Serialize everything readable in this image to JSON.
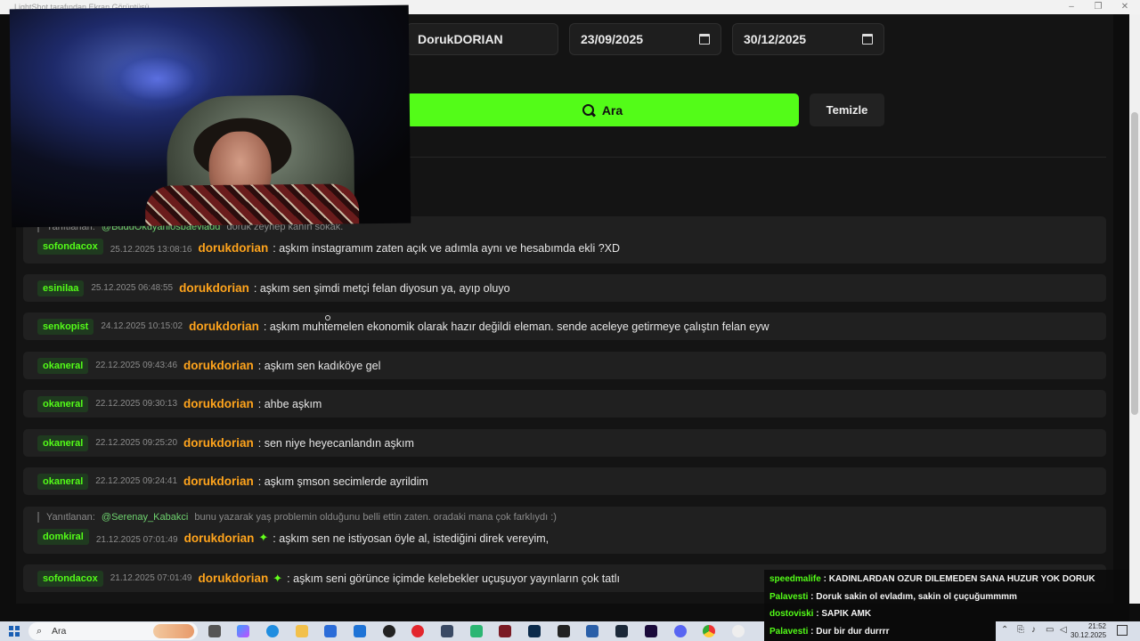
{
  "window": {
    "title": "LightShot tarafından Ekran Görüntüsü"
  },
  "filters": {
    "username": "DorukDORIAN",
    "date_from": "23/09/2025",
    "date_to": "30/12/2025",
    "search_label": "Ara",
    "clear_label": "Temizle"
  },
  "messages": [
    {
      "reply_label": "Yanıtlanan:",
      "reply_to": "@BuduOkuyaniosbaeviadd",
      "reply_text": "doruk zeynep kanın sokak.",
      "user": "sofondacox",
      "timestamp": "25.12.2025 13:08:16",
      "author": "dorukdorian",
      "sparkle": false,
      "text": ": aşkım instagramım zaten açık ve adımla aynı ve hesabımda ekli ?XD"
    },
    {
      "user": "esinilaa",
      "timestamp": "25.12.2025 06:48:55",
      "author": "dorukdorian",
      "sparkle": false,
      "text": ": aşkım sen şimdi metçi felan diyosun ya, ayıp oluyo"
    },
    {
      "user": "senkopist",
      "timestamp": "24.12.2025 10:15:02",
      "author": "dorukdorian",
      "sparkle": false,
      "text": ": aşkım muhtemelen ekonomik olarak hazır değildi eleman. sende aceleye getirmeye çalıştın felan eyw"
    },
    {
      "user": "okaneral",
      "timestamp": "22.12.2025 09:43:46",
      "author": "dorukdorian",
      "sparkle": false,
      "text": ": aşkım sen kadıköye gel"
    },
    {
      "user": "okaneral",
      "timestamp": "22.12.2025 09:30:13",
      "author": "dorukdorian",
      "sparkle": false,
      "text": ": ahbe aşkım"
    },
    {
      "user": "okaneral",
      "timestamp": "22.12.2025 09:25:20",
      "author": "dorukdorian",
      "sparkle": false,
      "text": ": sen niye heyecanlandın aşkım"
    },
    {
      "user": "okaneral",
      "timestamp": "22.12.2025 09:24:41",
      "author": "dorukdorian",
      "sparkle": false,
      "text": ": aşkım şmson secimlerde ayrildim"
    },
    {
      "reply_label": "Yanıtlanan:",
      "reply_to": "@Serenay_Kabakci",
      "reply_text": "bunu yazarak yaş problemin olduğunu belli ettin zaten. oradaki mana çok farklıydı :)",
      "user": "domkiral",
      "timestamp": "21.12.2025 07:01:49",
      "author": "dorukdorian",
      "sparkle": true,
      "text": ": aşkım sen ne istiyosan öyle al, istediğini direk vereyim,"
    },
    {
      "user": "sofondacox",
      "timestamp": "21.12.2025 07:01:49",
      "author": "dorukdorian",
      "sparkle": true,
      "text": ": aşkım seni görünce içimde kelebekler uçuşuyor yayınların çok tatlı"
    }
  ],
  "overlay_chat": [
    {
      "user": "speedmalife",
      "text": ": KADINLARDAN OZUR DILEMEDEN SANA HUZUR YOK DORUK"
    },
    {
      "user": "Palavesti",
      "text": ": Doruk sakin ol evladım, sakin ol çuçuğummmm"
    },
    {
      "user": "dostoviski",
      "text": ": SAPIK AMK"
    },
    {
      "user": "Palavesti",
      "text": ": Dur bir dur durrrr"
    }
  ],
  "taskbar": {
    "search_placeholder": "Ara",
    "time": "21:52",
    "date": "30.12.2025"
  }
}
